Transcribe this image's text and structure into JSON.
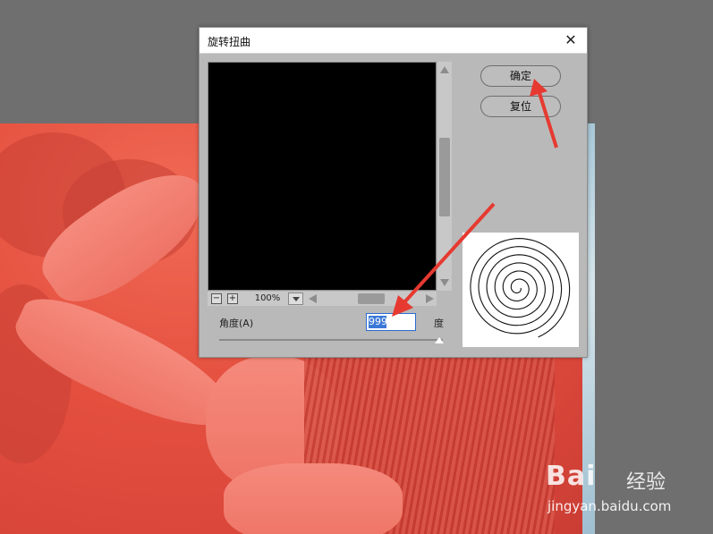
{
  "dialog": {
    "title": "旋转扭曲",
    "close_label": "✕",
    "ok_label": "确定",
    "reset_label": "复位",
    "zoom_out": "−",
    "zoom_in": "+",
    "zoom_value": "100%",
    "angle_label": "角度(A)",
    "angle_value": "999",
    "unit_label": "度"
  },
  "watermark": {
    "brand": "Bai",
    "brand_suffix": "经验",
    "url": "jingyan.baidu.com"
  },
  "colors": {
    "annotation_arrow": "#e63a31",
    "dialog_bg": "#b9b9b9",
    "preview_bg": "#000000"
  }
}
